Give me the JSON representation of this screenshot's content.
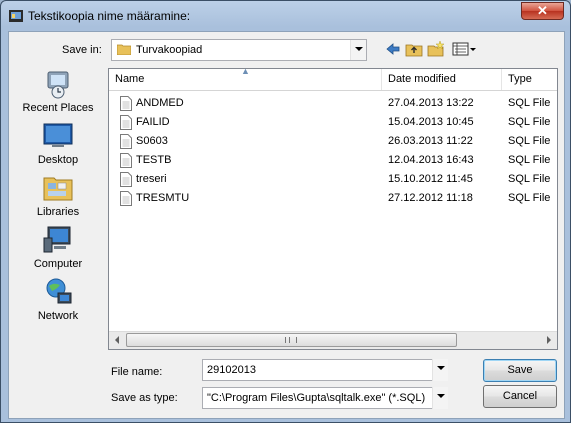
{
  "window": {
    "title": "Tekstikoopia nime määramine:"
  },
  "toolbar": {
    "save_in_label": "Save in:",
    "save_in_value": "Turvakoopiad"
  },
  "places": [
    {
      "label": "Recent Places",
      "icon": "recent-places-icon"
    },
    {
      "label": "Desktop",
      "icon": "desktop-icon"
    },
    {
      "label": "Libraries",
      "icon": "libraries-icon"
    },
    {
      "label": "Computer",
      "icon": "computer-icon"
    },
    {
      "label": "Network",
      "icon": "network-icon"
    }
  ],
  "files": {
    "columns": [
      "Name",
      "Date modified",
      "Type"
    ],
    "rows": [
      {
        "name": "ANDMED",
        "date": "27.04.2013 13:22",
        "type": "SQL File"
      },
      {
        "name": "FAILID",
        "date": "15.04.2013 10:45",
        "type": "SQL File"
      },
      {
        "name": "S0603",
        "date": "26.03.2013 11:22",
        "type": "SQL File"
      },
      {
        "name": "TESTB",
        "date": "12.04.2013 16:43",
        "type": "SQL File"
      },
      {
        "name": "treseri",
        "date": "15.10.2012 11:45",
        "type": "SQL File"
      },
      {
        "name": "TRESMTU",
        "date": "27.12.2012 11:18",
        "type": "SQL File"
      }
    ]
  },
  "form": {
    "file_name_label": "File name:",
    "file_name_value": "29102013",
    "save_as_type_label": "Save as type:",
    "save_as_type_value": "\"C:\\Program Files\\Gupta\\sqltalk.exe\" (*.SQL)"
  },
  "buttons": {
    "save": "Save",
    "cancel": "Cancel"
  },
  "colors": {
    "title_bar": "#a9c0dc",
    "close_button": "#c8432f",
    "accent_blue": "#3c7fb1"
  }
}
